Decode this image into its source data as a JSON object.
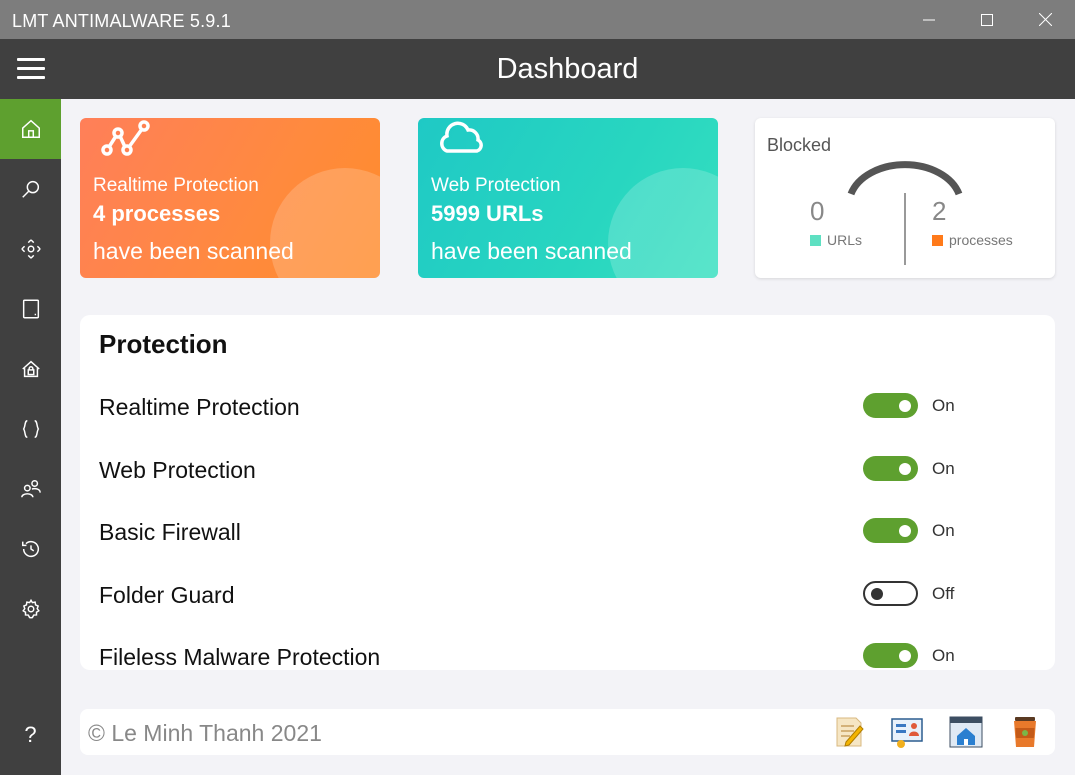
{
  "window": {
    "title": "LMT ANTIMALWARE 5.9.1",
    "controls": [
      "minimize-icon",
      "maximize-icon",
      "close-icon"
    ]
  },
  "header": {
    "title": "Dashboard",
    "menu_icon": "hamburger-menu-icon"
  },
  "sidebar": {
    "items": [
      {
        "icon": "home-icon",
        "active": true
      },
      {
        "icon": "search-icon"
      },
      {
        "icon": "target-scan-icon"
      },
      {
        "icon": "tablet-icon"
      },
      {
        "icon": "house-lock-icon"
      },
      {
        "icon": "curly-braces-icon"
      },
      {
        "icon": "users-icon"
      },
      {
        "icon": "history-icon"
      },
      {
        "icon": "gear-icon"
      }
    ],
    "help_label": "?"
  },
  "cards": {
    "realtime": {
      "icon": "network-graph-icon",
      "label": "Realtime Protection",
      "count": "4 processes",
      "sub": "have been scanned",
      "color": "#ff8a3e"
    },
    "web": {
      "icon": "cloud-icon",
      "label": "Web Protection",
      "count": "5999 URLs",
      "sub": "have been scanned",
      "color": "#28d6c0"
    },
    "blocked": {
      "title": "Blocked",
      "urls_value": "0",
      "urls_label": "URLs",
      "urls_color": "#5ee0c2",
      "processes_value": "2",
      "processes_label": "processes",
      "processes_color": "#ff7a1a"
    }
  },
  "protection": {
    "title": "Protection",
    "rows": [
      {
        "name": "Realtime Protection",
        "state": "On",
        "on": true
      },
      {
        "name": "Web Protection",
        "state": "On",
        "on": true
      },
      {
        "name": "Basic Firewall",
        "state": "On",
        "on": true
      },
      {
        "name": "Folder Guard",
        "state": "Off",
        "on": false
      },
      {
        "name": "Fileless Malware Protection",
        "state": "On",
        "on": true
      }
    ]
  },
  "footer": {
    "copyright": "© Le Minh Thanh 2021",
    "buttons": [
      "notepad-icon",
      "profile-icon",
      "website-home-icon",
      "coffee-cup-icon"
    ]
  },
  "colors": {
    "accent": "#5ea02f",
    "dark": "#404040",
    "titlebar": "#7d7d7d"
  }
}
